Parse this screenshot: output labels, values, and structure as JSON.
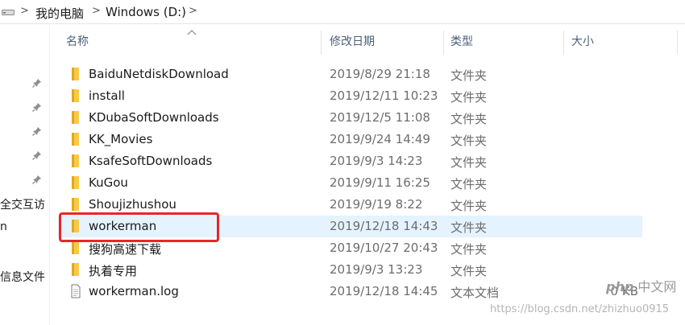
{
  "breadcrumb": {
    "items": [
      "我的电脑",
      "Windows (D:)"
    ],
    "separator": ">"
  },
  "nav_pane": {
    "visible_text": [
      "全交互访",
      "n",
      "信息文件"
    ]
  },
  "columns": {
    "name": "名称",
    "modified": "修改日期",
    "type": "类型",
    "size": "大小"
  },
  "files": [
    {
      "name": "BaiduNetdiskDownload",
      "modified": "2019/8/29 21:18",
      "type": "文件夹",
      "size": "",
      "kind": "folder"
    },
    {
      "name": "install",
      "modified": "2019/12/11 10:23",
      "type": "文件夹",
      "size": "",
      "kind": "folder"
    },
    {
      "name": "KDubaSoftDownloads",
      "modified": "2019/12/5 11:08",
      "type": "文件夹",
      "size": "",
      "kind": "folder"
    },
    {
      "name": "KK_Movies",
      "modified": "2019/9/24 14:49",
      "type": "文件夹",
      "size": "",
      "kind": "folder"
    },
    {
      "name": "KsafeSoftDownloads",
      "modified": "2019/9/3 14:23",
      "type": "文件夹",
      "size": "",
      "kind": "folder"
    },
    {
      "name": "KuGou",
      "modified": "2019/9/11 16:25",
      "type": "文件夹",
      "size": "",
      "kind": "folder"
    },
    {
      "name": "Shoujizhushou",
      "modified": "2019/9/19 8:22",
      "type": "文件夹",
      "size": "",
      "kind": "folder"
    },
    {
      "name": "workerman",
      "modified": "2019/12/18 14:43",
      "type": "文件夹",
      "size": "",
      "kind": "folder",
      "selected": true
    },
    {
      "name": "搜狗高速下载",
      "modified": "2019/10/27 20:43",
      "type": "文件夹",
      "size": "",
      "kind": "folder"
    },
    {
      "name": "执着专用",
      "modified": "2019/9/3 13:23",
      "type": "文件夹",
      "size": "",
      "kind": "folder"
    },
    {
      "name": "workerman.log",
      "modified": "2019/12/18 14:45",
      "type": "文本文档",
      "size": "0 KB",
      "kind": "text-file"
    }
  ],
  "watermark": {
    "logo_brand": "php",
    "logo_text": "中文网",
    "url": "https://blog.csdn.net/zhizhuo0915"
  },
  "colors": {
    "folder": "#f7c948",
    "selected_row": "#e5f3ff",
    "highlight_border": "#e8262a",
    "header_text": "#4c607a"
  }
}
